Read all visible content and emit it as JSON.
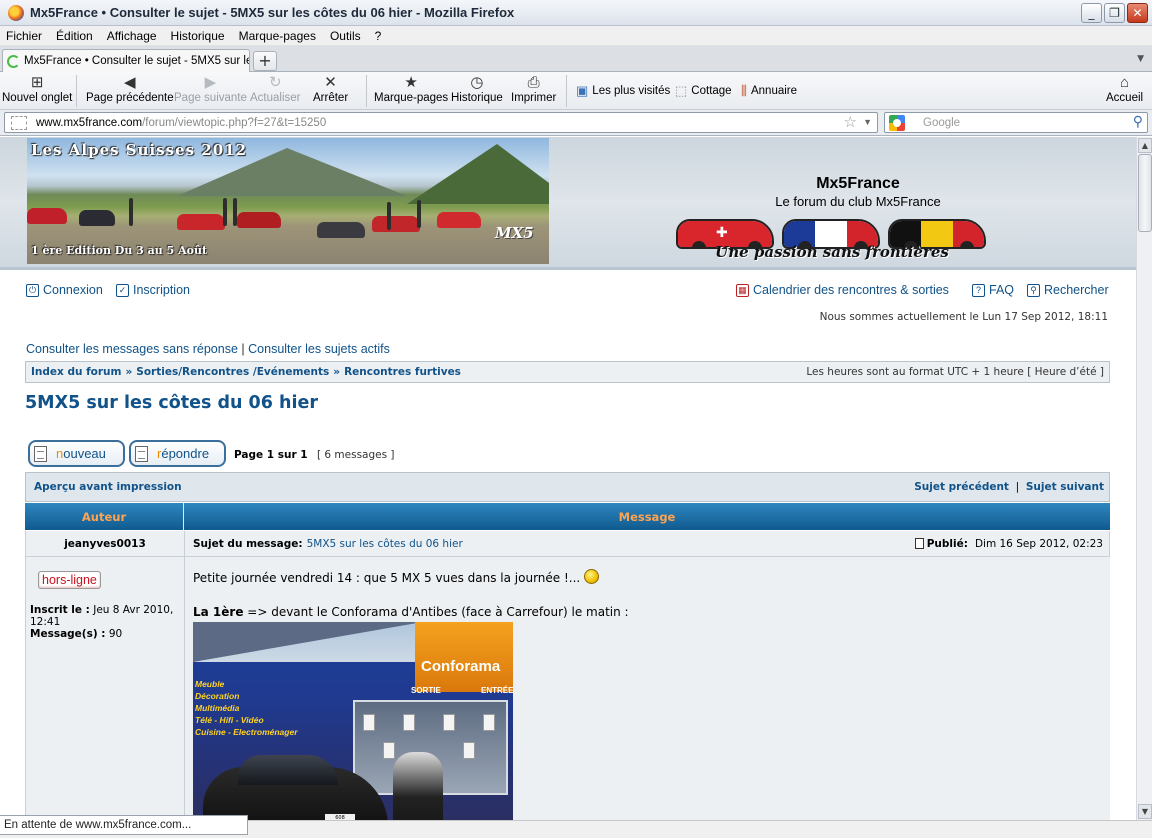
{
  "window": {
    "title": "Mx5France • Consulter le sujet - 5MX5 sur les côtes du 06 hier - Mozilla Firefox",
    "controls": {
      "minimize": "_",
      "maximize": "❐",
      "close": "✕"
    }
  },
  "menu": [
    "Fichier",
    "Édition",
    "Affichage",
    "Historique",
    "Marque-pages",
    "Outils",
    "?"
  ],
  "tabs": [
    {
      "label": "Mx5France • Consulter le sujet - 5MX5 sur le..."
    }
  ],
  "toolbar": {
    "new_tab": "Nouvel onglet",
    "back": "Page précédente",
    "forward": "Page suivante",
    "reload": "Actualiser",
    "stop": "Arrêter",
    "bookmarks": "Marque-pages",
    "history": "Historique",
    "print": "Imprimer",
    "home": "Accueil",
    "bookmarks_bar": [
      "Les plus visités",
      "Cottage",
      "Annuaire"
    ]
  },
  "url": {
    "host": "www.mx5france.com",
    "path": "/forum/viewtopic.php?f=27&t=15250"
  },
  "search": {
    "placeholder": "Google"
  },
  "status": {
    "text": "En attente de www.mx5france.com..."
  },
  "page": {
    "banner": {
      "title": "Les Alpes Suisses 2012",
      "subtitle": "1 ère Edition Du 3 au 5 Août",
      "logo": "MX5"
    },
    "site_name": "Mx5France",
    "site_desc": "Le forum du club Mx5France",
    "slogan": "Une passion sans frontières",
    "nav": {
      "login": "Connexion",
      "register": "Inscription",
      "calendar": "Calendrier des rencontres & sorties",
      "faq": "FAQ",
      "search": "Rechercher"
    },
    "date_line": "Nous sommes actuellement le Lun 17 Sep 2012, 18:11",
    "search_links": {
      "unanswered": "Consulter les messages sans réponse",
      "sep": "|",
      "active": "Consulter les sujets actifs"
    },
    "breadcrumbs": [
      "Index du forum",
      "Sorties/Rencontres /Evénements",
      "Rencontres furtives"
    ],
    "breadcrumb_sep": "»",
    "timezone": "Les heures sont au format UTC + 1 heure [ Heure d’été ]",
    "topic_title": "5MX5 sur les côtes du 06 hier",
    "buttons": {
      "new_first": "n",
      "new_rest": "ouveau",
      "reply_first": "r",
      "reply_rest": "épondre"
    },
    "pagination": {
      "pages": "Page 1 sur 1",
      "count": "[ 6 messages ]"
    },
    "print_view": "Aperçu avant impression",
    "prev_topic": "Sujet précédent",
    "next_topic": "Sujet suivant",
    "headers": {
      "author": "Auteur",
      "message": "Message"
    },
    "post": {
      "author": "jeanyves0013",
      "subject_label": "Sujet du message:",
      "subject": "5MX5 sur les côtes du 06 hier",
      "published_label": "Publié:",
      "published": "Dim 16 Sep 2012, 02:23",
      "online_status": "hors-ligne",
      "joined_label": "Inscrit le :",
      "joined": "Jeu 8 Avr 2010, 12:41",
      "posts_label": "Message(s) :",
      "posts": "90",
      "line1": "Petite journée vendredi 14 : que 5 MX 5 vues dans la journée !...",
      "line2_bold": "La 1ère",
      "line2_rest": " => devant le Conforama d'Antibes (face à Carrefour) le matin :"
    },
    "photo_text": {
      "brand": "Conforama",
      "sortie": "SORTIE",
      "entree": "ENTRÉE",
      "departments": [
        "Meuble",
        "Décoration",
        "Multimédia",
        "Télé - Hifi - Vidéo",
        "Cuisine - Electroménager"
      ],
      "plate": "608"
    }
  }
}
